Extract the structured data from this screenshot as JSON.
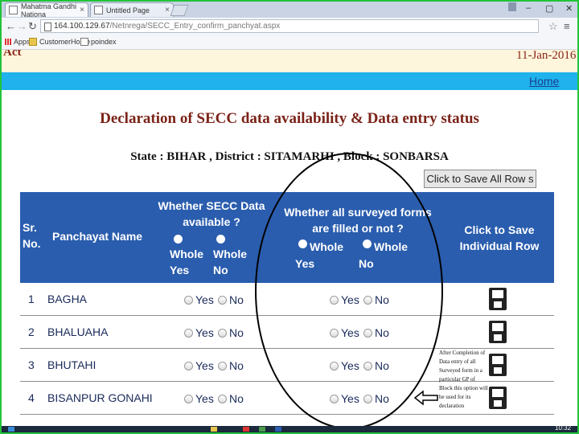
{
  "browser": {
    "tabs": [
      {
        "label": "Mahatma Gandhi Nationa",
        "close": "×"
      },
      {
        "label": "Untitled Page",
        "close": "×"
      }
    ],
    "window_controls": {
      "minimize": "–",
      "maximize": "▢",
      "close": "✕"
    },
    "address": {
      "host": "164.100.129.67",
      "path": "/Netnrega/SECC_Entry_confirm_panchyat.aspx"
    },
    "bookmarks": [
      "Apps",
      "CustomerHome",
      "poindex"
    ]
  },
  "header": {
    "act_text": "Act",
    "date": "11-Jan-2016",
    "home_link": "Home"
  },
  "page": {
    "title": "Declaration of SECC data availability & Data entry status",
    "subtitle": "State : BIHAR , District : SITAMARHI , Block : SONBARSA",
    "save_all_button": "Click to Save All Row s"
  },
  "table": {
    "headers": {
      "sr_line1": "Sr.",
      "sr_line2": "No.",
      "panchayat": "Panchayat Name",
      "secc_line1": "Whether SECC Data",
      "secc_line2": "available ?",
      "secc_opt1a": "Whole",
      "secc_opt1b": "Yes",
      "secc_opt2a": "Whole",
      "secc_opt2b": "No",
      "forms_line1": "Whether all surveyed forms",
      "forms_line2": "are filled or not ?",
      "forms_opt1a": "Whole",
      "forms_opt1b": "Yes",
      "forms_opt2a": "Whole",
      "forms_opt2b": "No",
      "save_line1": "Click to Save",
      "save_line2": "Individual Row"
    },
    "yes_label": "Yes",
    "no_label": "No",
    "rows": [
      {
        "sr": "1",
        "name": "BAGHA"
      },
      {
        "sr": "2",
        "name": "BHALUAHA"
      },
      {
        "sr": "3",
        "name": "BHUTAHI"
      },
      {
        "sr": "4",
        "name": "BISANPUR GONAHI"
      }
    ]
  },
  "annotation": "After Completion of Data entry of all Surveyed form in a particular GP of Block this option will be used for its declaration",
  "taskbar": {
    "time": "10:32"
  },
  "colors": {
    "header_blue": "#2a5dae",
    "accent_cyan": "#1fb2ec",
    "title_maroon": "#7b2318",
    "frame_green": "#22c33a"
  }
}
